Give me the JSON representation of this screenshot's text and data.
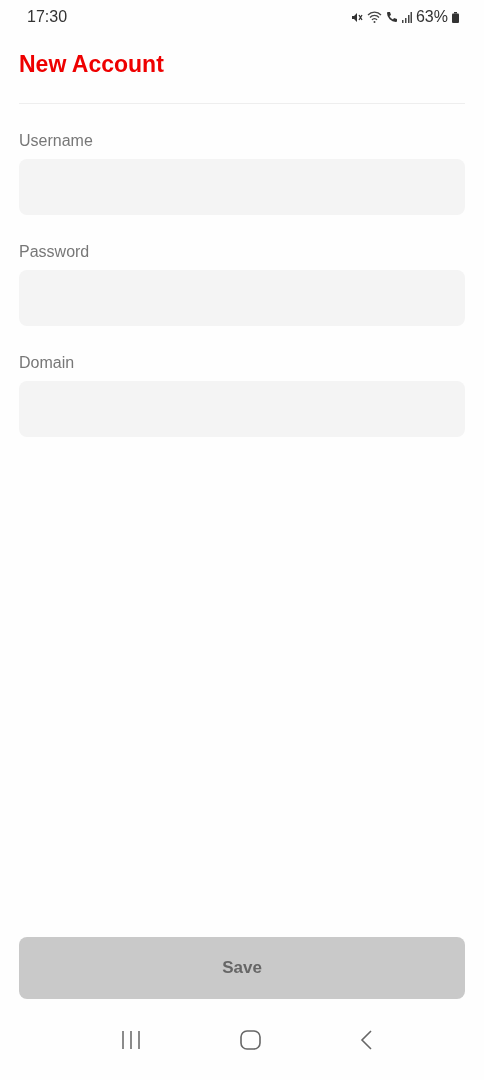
{
  "status_bar": {
    "time": "17:30",
    "battery": "63%"
  },
  "title": "New Account",
  "fields": [
    {
      "label": "Username"
    },
    {
      "label": "Password"
    },
    {
      "label": "Domain"
    }
  ],
  "save_button": {
    "label": "Save",
    "disabled": true
  }
}
